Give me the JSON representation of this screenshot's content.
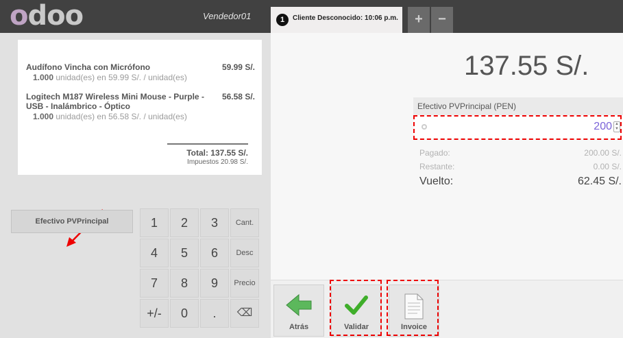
{
  "header": {
    "logo": "odoo",
    "vendor": "Vendedor01",
    "order_tab": {
      "number": "1",
      "label": "Cliente Desconocido: 10:06 p.m."
    },
    "add_label": "+",
    "remove_label": "−"
  },
  "receipt": {
    "lines": [
      {
        "name": "Audífono Vincha con Micrófono",
        "price": "59.99 S/.",
        "qty": "1.000",
        "detail": " unidad(es) en 59.99 S/. / unidad(es)"
      },
      {
        "name": "Logitech M187 Wireless Mini Mouse - Purple - USB - Inalámbrico - Óptico",
        "price": "56.58 S/.",
        "qty": "1.000",
        "detail": " unidad(es) en 56.58 S/. / unidad(es)"
      }
    ],
    "total": "Total: 137.55 S/.",
    "taxes": "Impuestos 20.98 S/."
  },
  "payment_method_button": "Efectivo PVPrincipal",
  "numpad": {
    "keys": [
      "1",
      "2",
      "3",
      "Cant.",
      "4",
      "5",
      "6",
      "Desc",
      "7",
      "8",
      "9",
      "Precio",
      "+/-",
      "0",
      ".",
      "⌫"
    ]
  },
  "payment": {
    "due_amount": "137.55 S/.",
    "line_header": "Efectivo PVPrincipal (PEN)",
    "line_value": "200",
    "paid_label": "Pagado:",
    "paid_value": "200.00 S/.",
    "remaining_label": "Restante:",
    "remaining_value": "0.00 S/.",
    "change_label": "Vuelto:",
    "change_value": "62.45 S/."
  },
  "actions": {
    "back": "Atrás",
    "validate": "Validar",
    "invoice": "Invoice"
  },
  "colors": {
    "topbar": "#414141",
    "accent_value": "#7a63d8",
    "highlight": "#e00000",
    "validate_green": "#3fae2a"
  }
}
